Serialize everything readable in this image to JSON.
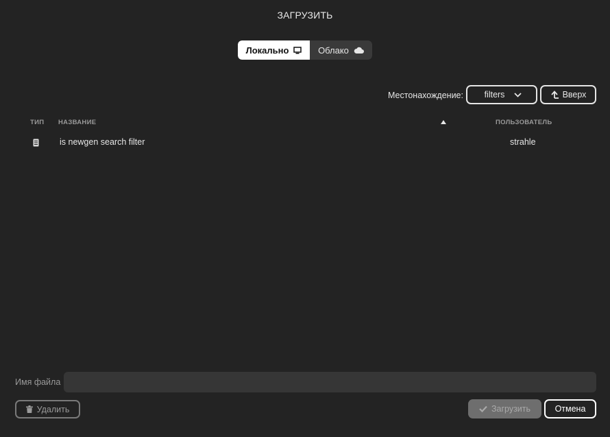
{
  "dialog": {
    "title": "ЗАГРУЗИТЬ"
  },
  "source_toggle": {
    "local_label": "Локально",
    "local_icon": "monitor-icon",
    "cloud_label": "Облако",
    "cloud_icon": "cloud-icon",
    "selected": "Локально"
  },
  "location": {
    "label": "Местонахождение:",
    "value": "filters",
    "dropdown_icon": "chevron-down-icon",
    "up_label": "Вверх",
    "up_icon": "arrow-up-icon"
  },
  "table": {
    "columns": {
      "type": "ТИП",
      "name": "НАЗВАНИЕ",
      "user": "ПОЛЬЗОВАТЕЛЬ"
    },
    "sort_icon": "sort-ascending-icon",
    "rows": [
      {
        "type_icon": "document-icon",
        "name": "is newgen search filter",
        "user": "strahle"
      }
    ]
  },
  "footer": {
    "filename_label": "Имя файла",
    "filename_value": "",
    "filename_placeholder": "",
    "delete_label": "Удалить",
    "delete_icon": "trash-icon",
    "load_label": "Загрузить",
    "load_icon": "checkmark-icon",
    "cancel_label": "Отмена"
  },
  "colors": {
    "background": "#232323",
    "input_bg": "#363636",
    "text": "#e6e6e6",
    "muted_text": "#9a9a9a",
    "disabled_button": "#6e6e6e"
  }
}
